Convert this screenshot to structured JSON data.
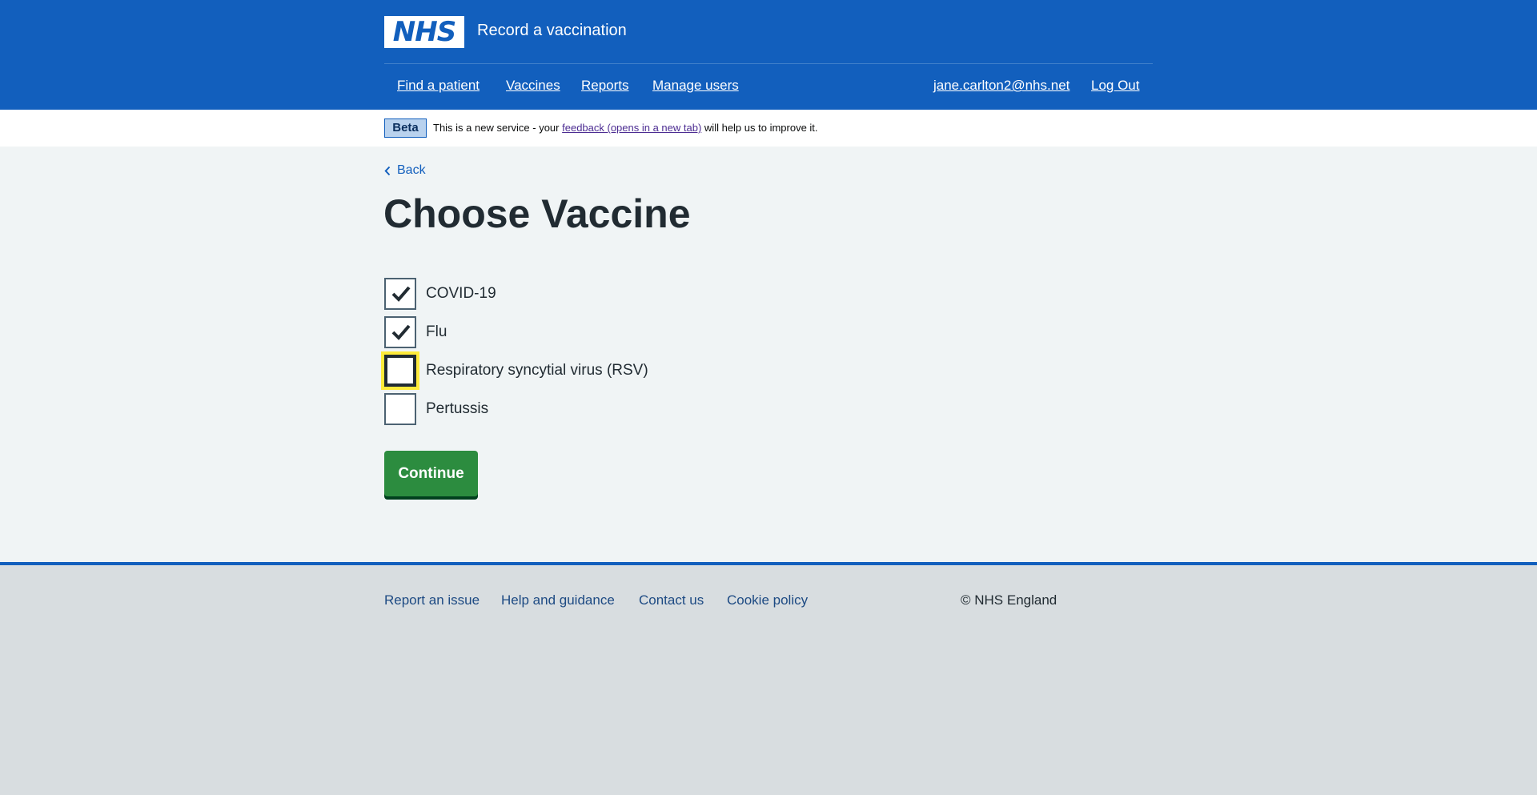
{
  "header": {
    "logo_text": "NHS",
    "service_name": "Record a vaccination",
    "nav": {
      "find_patient": "Find a patient",
      "vaccines": "Vaccines",
      "reports": "Reports",
      "manage_users": "Manage users",
      "user_email": "jane.carlton2@nhs.net",
      "log_out": "Log Out"
    }
  },
  "beta_banner": {
    "tag": "Beta",
    "text_before": "This is a new service - your",
    "link": "feedback (opens in a new tab)",
    "text_after": "will help us to improve it."
  },
  "main": {
    "back_label": "Back",
    "title": "Choose Vaccine",
    "options": [
      {
        "label": "COVID-19",
        "checked": true
      },
      {
        "label": "Flu",
        "checked": true
      },
      {
        "label": "Respiratory syncytial virus (RSV)",
        "checked": false,
        "focused": true
      },
      {
        "label": "Pertussis",
        "checked": false
      }
    ],
    "continue_label": "Continue"
  },
  "footer": {
    "report_issue": "Report an issue",
    "help": "Help and guidance",
    "contact": "Contact us",
    "cookie": "Cookie policy",
    "copyright": "© NHS England"
  },
  "colors": {
    "header_blue": "#125fbd",
    "page_bg": "#f0f4f5",
    "footer_bg": "#d8dde0",
    "button_green": "#2c8c3f",
    "focus_yellow": "#ffeb3b"
  }
}
